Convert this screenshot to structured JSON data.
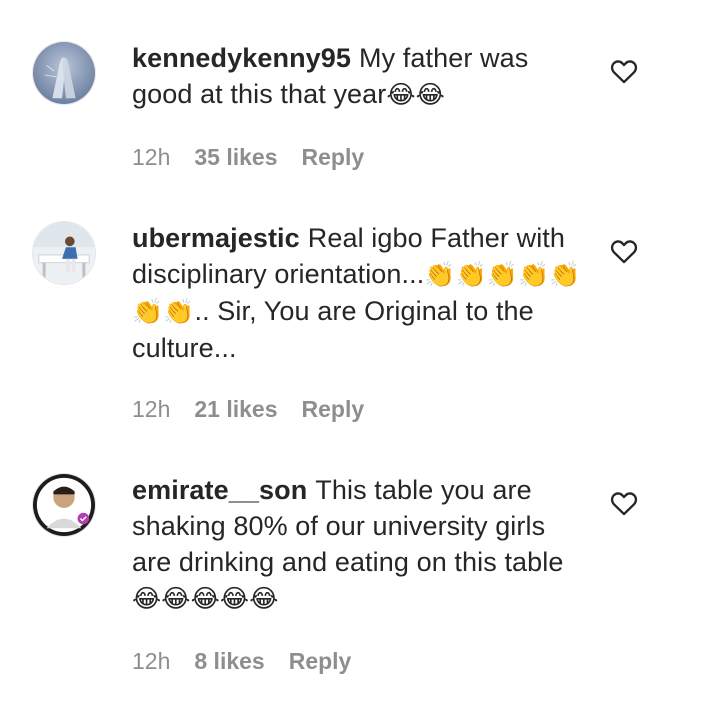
{
  "comments": [
    {
      "username": "kennedykenny95",
      "text": "My father was good at this that year",
      "emoji": "😂😂",
      "time": "12h",
      "likes": "35 likes",
      "reply": "Reply",
      "avatar": "praying-hands-avatar"
    },
    {
      "username": "ubermajestic",
      "text": "Real igbo Father with disciplinary orientation...",
      "emoji": "👏👏👏👏👏👏👏",
      "text2": ".. Sir, You are Original to the culture...",
      "time": "12h",
      "likes": "21 likes",
      "reply": "Reply",
      "avatar": "man-at-table-avatar"
    },
    {
      "username": "emirate__son",
      "text": "This table you are shaking 80% of our university girls are drinking and eating on this table",
      "emoji": "😂😂😂😂😂",
      "time": "12h",
      "likes": "8 likes",
      "reply": "Reply",
      "avatar": "man-portrait-avatar"
    }
  ],
  "icons": {
    "like": "heart-outline-icon"
  },
  "colors": {
    "text": "#262626",
    "muted": "#8e8e8e",
    "background": "#ffffff"
  }
}
